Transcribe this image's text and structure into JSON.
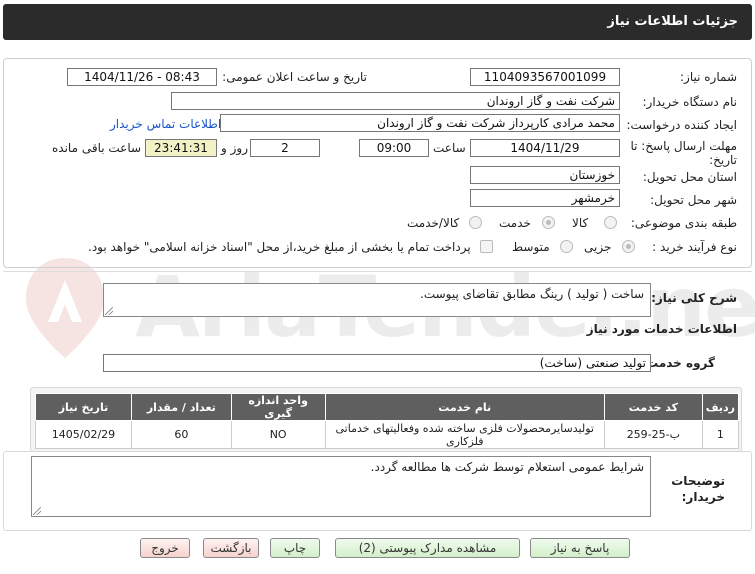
{
  "header": {
    "title": "جزئیات اطلاعات نیاز"
  },
  "fields": {
    "need_number_label": "شماره نیاز:",
    "need_number": "1104093567001099",
    "announce_label": "تاریخ و ساعت اعلان عمومی:",
    "announce_value": "1404/11/26 - 08:43",
    "buyer_org_label": "نام دستگاه خریدار:",
    "buyer_org": "شرکت نفت و گاز اروندان",
    "requester_label": "ایجاد کننده درخواست:",
    "requester": "محمد مرادی کارپرداز شرکت نفت و گاز اروندان",
    "contact_link": "اطلاعات تماس خریدار",
    "deadline_label_1": "مهلت ارسال پاسخ: تا",
    "deadline_label_2": "تاریخ:",
    "deadline_date": "1404/11/29",
    "time_label": "ساعت",
    "deadline_time": "09:00",
    "days_value": "2",
    "days_label": "روز و",
    "remaining_time": "23:41:31",
    "remaining_label": "ساعت باقی مانده",
    "province_label": "استان محل تحویل:",
    "province": "خوزستان",
    "city_label": "شهر محل تحویل:",
    "city": "خرمشهر",
    "category_label": "طبقه بندی موضوعی:",
    "category_options": [
      "کالا",
      "خدمت",
      "کالا/خدمت"
    ],
    "purchase_label": "نوع فرآیند خرید :",
    "purchase_options": [
      "جزیی",
      "متوسط"
    ],
    "purchase_note": "پرداخت تمام یا بخشی از مبلغ خرید،از محل \"اسناد خزانه اسلامی\" خواهد بود."
  },
  "description": {
    "label": "شرح کلی نیاز:",
    "text": "ساخت ( تولید ) رینگ مطابق تقاضای پیوست."
  },
  "services": {
    "section_title": "اطلاعات خدمات مورد نیاز",
    "group_label": "گروه خدمت:",
    "group_value": "تولید صنعتی (ساخت)",
    "table": {
      "headers": [
        "ردیف",
        "کد خدمت",
        "نام خدمت",
        "واحد اندازه گیری",
        "تعداد / مقدار",
        "تاریخ نیاز"
      ],
      "rows": [
        [
          "1",
          "ب-25-259",
          "تولیدسایرمحصولات فلزی ساخته شده وفعالیتهای خدماتی فلزکاری",
          "NO",
          "60",
          "1405/02/29"
        ]
      ]
    }
  },
  "notes": {
    "label_1": "توضیحات",
    "label_2": "خریدار:",
    "text": "شرایط عمومی استعلام توسط شرکت ها مطالعه گردد."
  },
  "buttons": {
    "reply": "پاسخ به نیاز",
    "view_docs": "مشاهده مدارک پیوستی (2)",
    "print": "چاپ",
    "back": "بازگشت",
    "exit": "خروج"
  },
  "watermark": "AriaTender.net",
  "colors": {
    "header_bg": "#2b2b2b",
    "remaining_bg": "#f3f1c6",
    "link": "#1a56c8",
    "green_button": "#d2efc9",
    "pink_button": "#f6d2cc"
  }
}
